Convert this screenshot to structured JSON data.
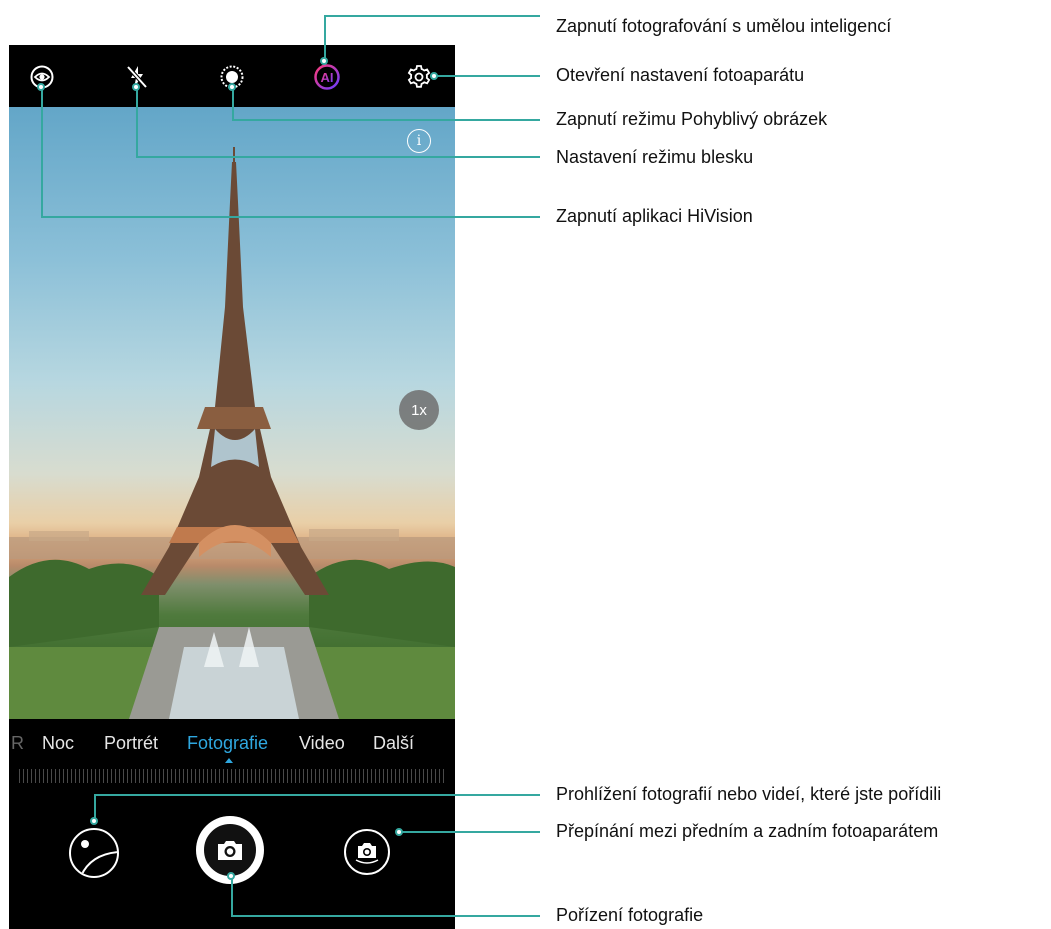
{
  "top_bar": {
    "icons": [
      "hivision-icon",
      "flash-off-icon",
      "moving-picture-icon",
      "ai-icon",
      "settings-icon"
    ],
    "ai_text": "AI"
  },
  "viewfinder": {
    "zoom": "1x",
    "info_icon": "info-icon"
  },
  "modes": {
    "items": [
      "Noc",
      "Portrét",
      "Fotografie",
      "Video",
      "Další"
    ],
    "selected": "Fotografie",
    "accent": "#2fa8e0"
  },
  "controls": {
    "gallery_icon": "gallery-icon",
    "shutter_icon": "camera-icon",
    "switch_icon": "switch-camera-icon"
  },
  "annotations": {
    "ai": "Zapnutí fotografování s umělou inteligencí",
    "settings": "Otevření nastavení fotoaparátu",
    "moving_picture": "Zapnutí režimu Pohyblivý obrázek",
    "flash": "Nastavení režimu blesku",
    "hivision": "Zapnutí aplikaci HiVision",
    "gallery": "Prohlížení fotografií nebo videí, které jste pořídili",
    "switch": "Přepínání mezi předním a zadním fotoaparátem",
    "shutter": "Pořízení fotografie"
  },
  "colors": {
    "callout_line": "#35a8a0",
    "ai_gradient": [
      "#ff3b7a",
      "#6a3cff"
    ]
  }
}
